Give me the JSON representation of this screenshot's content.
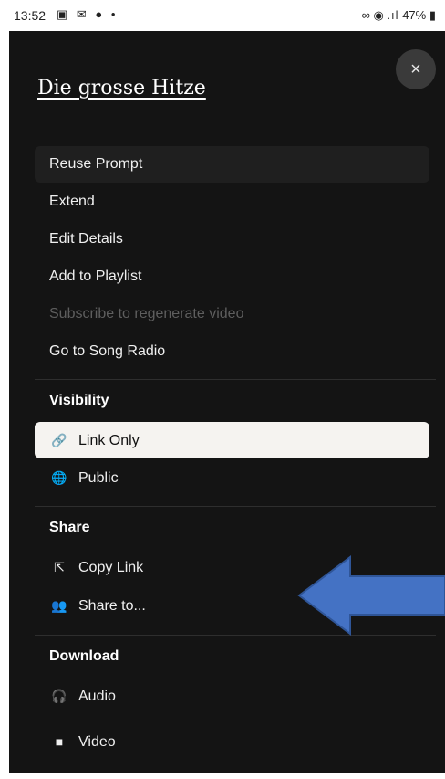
{
  "status_bar": {
    "time": "13:52",
    "left_icons": "▣ ✉ ● •",
    "right_icons": "∞ ◉",
    "signal": ".ıl",
    "battery": "47%"
  },
  "title": "Die grosse Hitze",
  "close_label": "×",
  "menu": [
    {
      "label": "Reuse Prompt"
    },
    {
      "label": "Extend"
    },
    {
      "label": "Edit Details"
    },
    {
      "label": "Add to Playlist"
    },
    {
      "label": "Subscribe to regenerate video"
    },
    {
      "label": "Go to Song Radio"
    }
  ],
  "visibility": {
    "header": "Visibility",
    "options": [
      {
        "icon": "link-icon",
        "glyph": "🔗",
        "label": "Link Only"
      },
      {
        "icon": "globe-icon",
        "glyph": "🌐",
        "label": "Public"
      }
    ]
  },
  "share": {
    "header": "Share",
    "options": [
      {
        "icon": "share-external-icon",
        "glyph": "⇱",
        "label": "Copy Link"
      },
      {
        "icon": "people-icon",
        "glyph": "👥",
        "label": "Share to..."
      }
    ]
  },
  "download": {
    "header": "Download",
    "options": [
      {
        "icon": "headphones-icon",
        "glyph": "🎧",
        "label": "Audio"
      },
      {
        "icon": "video-camera-icon",
        "glyph": "■",
        "label": "Video"
      }
    ]
  },
  "colors": {
    "sheet_bg": "#141414",
    "selected_bg": "#f5f3f0",
    "arrow_fill": "#4472c4",
    "arrow_stroke": "#2f5597"
  }
}
